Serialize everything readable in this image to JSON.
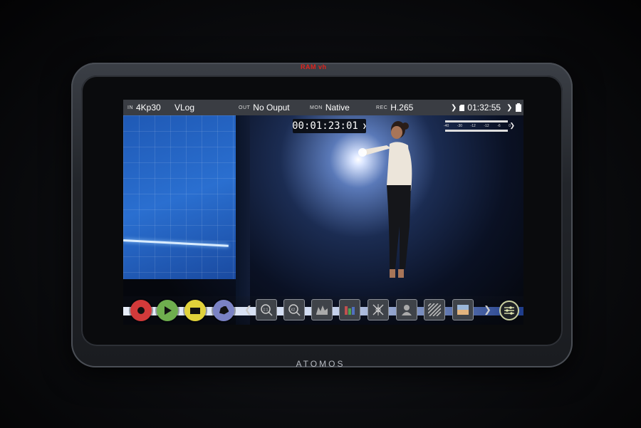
{
  "device": {
    "top_label": "RAM vh",
    "brand": "ATOMOS"
  },
  "status_bar": {
    "in_tag": "IN",
    "in_value": "4Kp30",
    "profile": "VLog",
    "out_tag": "OUT",
    "out_value": "No Ouput",
    "mon_tag": "MON",
    "mon_value": "Native",
    "rec_tag": "REC",
    "rec_value": "H.265",
    "remaining_time": "01:32:55",
    "icons": [
      "chevron-right-icon",
      "storage-card-icon",
      "battery-icon"
    ]
  },
  "timecode": {
    "value": "00:01:23:01",
    "icon": "chevron-right-icon"
  },
  "audio_meter": {
    "scale": [
      "-40",
      "-30",
      "-12",
      "-12",
      "-6",
      "0"
    ],
    "icon": "chevron-right-icon"
  },
  "controls": {
    "transport": [
      {
        "name": "record",
        "icon": "record-icon",
        "color": "#d33a3a"
      },
      {
        "name": "play",
        "icon": "play-icon",
        "color": "#6fae4e"
      },
      {
        "name": "stop",
        "icon": "stop-icon",
        "color": "#e1d23a"
      },
      {
        "name": "tag",
        "icon": "tag-icon",
        "color": "#7a82c4"
      }
    ],
    "tools": [
      {
        "name": "zoom-1-1",
        "icon": "zoom-1-1-icon",
        "label": "1:1"
      },
      {
        "name": "zoom-x2",
        "icon": "zoom-x2-icon",
        "label": "X2"
      },
      {
        "name": "waveform",
        "icon": "waveform-icon"
      },
      {
        "name": "rgb-parade",
        "icon": "rgb-parade-icon"
      },
      {
        "name": "vectorscope",
        "icon": "vectorscope-icon"
      },
      {
        "name": "false-color",
        "icon": "false-color-icon"
      },
      {
        "name": "zebra",
        "icon": "zebra-icon"
      },
      {
        "name": "lut",
        "icon": "lut-icon"
      }
    ],
    "more_icon": "chevron-right-icon",
    "settings_icon": "settings-sliders-icon"
  }
}
